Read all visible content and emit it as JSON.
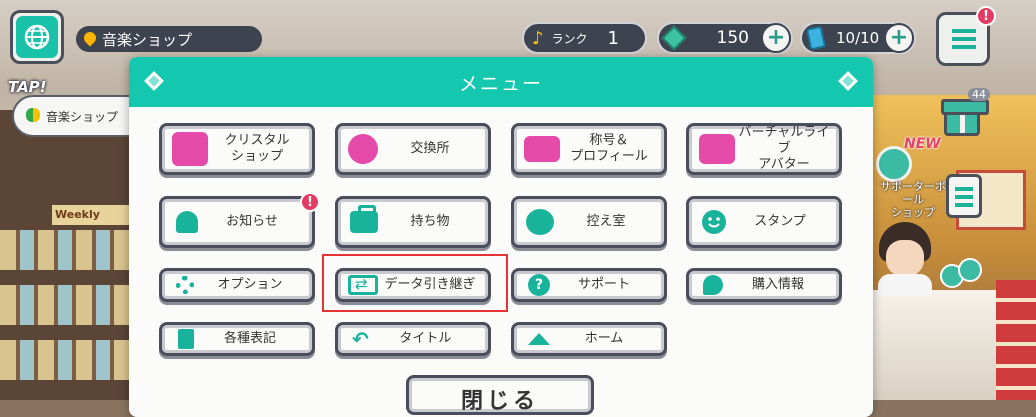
{
  "hud": {
    "location": "音楽ショップ",
    "tap_badge": "TAP!",
    "location_card": "音楽ショップ",
    "rank_label": "ランク",
    "rank_value": "1",
    "crystal_count": "150",
    "live_tickets": "10/10",
    "alert_mark": "!",
    "gift_count": "44",
    "new_tag": "NEW",
    "pro_label": "サポーターボール\nショップ",
    "weekly_sign": "Weekly"
  },
  "modal": {
    "title": "メニュー",
    "buttons": [
      {
        "id": "crystal-shop",
        "label": "クリスタル\nショップ",
        "icon": "crystal-shop-icon"
      },
      {
        "id": "exchange",
        "label": "交換所",
        "icon": "coins-icon"
      },
      {
        "id": "title-profile",
        "label": "称号＆\nプロフィール",
        "icon": "profile-card-icon"
      },
      {
        "id": "virtual-live-avatar",
        "label": "バーチャルライブ\nアバター",
        "icon": "avatar-icon"
      },
      {
        "id": "notice",
        "label": "お知らせ",
        "icon": "bell-icon"
      },
      {
        "id": "inventory",
        "label": "持ち物",
        "icon": "bag-icon"
      },
      {
        "id": "waiting-room",
        "label": "控え室",
        "icon": "waiting-room-icon"
      },
      {
        "id": "stamp",
        "label": "スタンプ",
        "icon": "smile-icon"
      },
      {
        "id": "options",
        "label": "オプション",
        "icon": "gear-icon"
      },
      {
        "id": "data-transfer",
        "label": "データ引き継ぎ",
        "icon": "transfer-icon"
      },
      {
        "id": "support",
        "label": "サポート",
        "icon": "help-icon"
      },
      {
        "id": "purchase-info",
        "label": "購入情報",
        "icon": "tag-icon"
      },
      {
        "id": "legal-notices",
        "label": "各種表記",
        "icon": "document-icon"
      },
      {
        "id": "title-screen",
        "label": "タイトル",
        "icon": "return-arrow-icon"
      },
      {
        "id": "home",
        "label": "ホーム",
        "icon": "home-icon"
      }
    ],
    "close_label": "閉じる"
  },
  "colors": {
    "accent": "#14c8b0",
    "alert": "#e43b63",
    "highlight": "#e53232"
  }
}
